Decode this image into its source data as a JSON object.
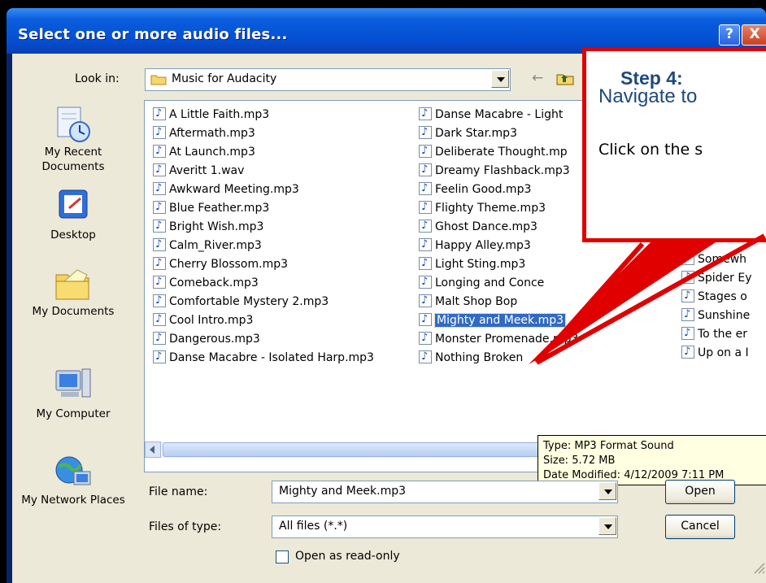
{
  "window": {
    "title": "Select one or more audio files...",
    "help_glyph": "?",
    "close_glyph": "X"
  },
  "lookin": {
    "label": "Look in:",
    "value": "Music for Audacity",
    "back_glyph": "←"
  },
  "places": [
    {
      "label": "My Recent Documents",
      "icon": "recent-documents-icon"
    },
    {
      "label": "Desktop",
      "icon": "desktop-icon"
    },
    {
      "label": "My Documents",
      "icon": "my-documents-icon"
    },
    {
      "label": "My Computer",
      "icon": "my-computer-icon"
    },
    {
      "label": "My Network Places",
      "icon": "network-places-icon"
    }
  ],
  "files": {
    "col1": [
      "A Little Faith.mp3",
      "Aftermath.mp3",
      "At Launch.mp3",
      "Averitt 1.wav",
      "Awkward Meeting.mp3",
      "Blue Feather.mp3",
      "Bright Wish.mp3",
      "Calm_River.mp3",
      "Cherry Blossom.mp3",
      "Comeback.mp3",
      "Comfortable Mystery 2.mp3",
      "Cool Intro.mp3",
      "Dangerous.mp3",
      "Danse Macabre - Isolated Harp.mp3"
    ],
    "col2": [
      "Danse Macabre - Light",
      "Dark Star.mp3",
      "Deliberate Thought.mp",
      "Dreamy Flashback.mp3",
      "Feelin Good.mp3",
      "Flighty Theme.mp3",
      "Ghost Dance.mp3",
      "Happy Alley.mp3",
      "Light Sting.mp3",
      "Longing and Conce",
      "Malt Shop Bop",
      "Mighty and Meek.mp3",
      "Monster Promenade.mp3",
      "Nothing Broken"
    ],
    "col3": [
      "Somewh",
      "Spider Ey",
      "Stages o",
      "Sunshine",
      "To the er",
      "Up on a I"
    ],
    "selected": "Mighty and Meek.mp3"
  },
  "tooltip": {
    "type": "Type: MP3 Format Sound",
    "size": "Size: 5.72 MB",
    "date": "Date Modified: 4/12/2009 7:11 PM"
  },
  "filename": {
    "label": "File name:",
    "value": "Mighty and Meek.mp3"
  },
  "filetype": {
    "label": "Files of type:",
    "value": "All files (*.*)"
  },
  "buttons": {
    "open": "Open",
    "cancel": "Cancel"
  },
  "readonly_label": "Open as read-only",
  "callout": {
    "step": "Step 4:",
    "navigate": "Navigate to",
    "click": "Click on the s"
  },
  "colors": {
    "title_bar": "#0450d4",
    "selection": "#316ac5",
    "callout_border": "#e00000",
    "callout_text": "#1f497d",
    "tooltip_bg": "#ffffe1"
  }
}
